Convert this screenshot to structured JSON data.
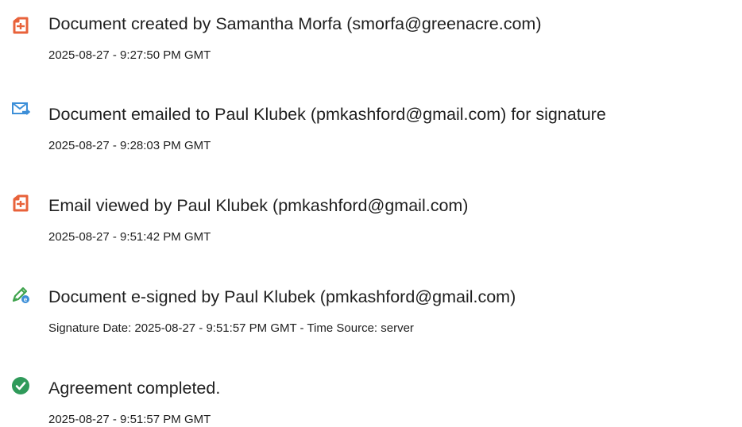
{
  "events": [
    {
      "icon": "document-icon",
      "title": "Document created by Samantha Morfa (smorfa@greenacre.com)",
      "timestamp": "2025-08-27 - 9:27:50 PM GMT"
    },
    {
      "icon": "email-send-icon",
      "title": "Document emailed to Paul Klubek (pmkashford@gmail.com) for signature",
      "timestamp": "2025-08-27 - 9:28:03 PM GMT"
    },
    {
      "icon": "document-icon",
      "title": "Email viewed by Paul Klubek (pmkashford@gmail.com)",
      "timestamp": "2025-08-27 - 9:51:42 PM GMT"
    },
    {
      "icon": "esign-pen-icon",
      "title": "Document e-signed by Paul Klubek (pmkashford@gmail.com)",
      "timestamp": "Signature Date: 2025-08-27 - 9:51:57 PM GMT - Time Source: server"
    },
    {
      "icon": "check-circle-icon",
      "title": "Agreement completed.",
      "timestamp": "2025-08-27 - 9:51:57 PM GMT"
    }
  ],
  "colors": {
    "document_icon": "#e8623a",
    "email_icon": "#3d8fd8",
    "esign_icon": "#3fa34d",
    "check_icon": "#2f9a5a",
    "text": "#1f1f1f"
  }
}
